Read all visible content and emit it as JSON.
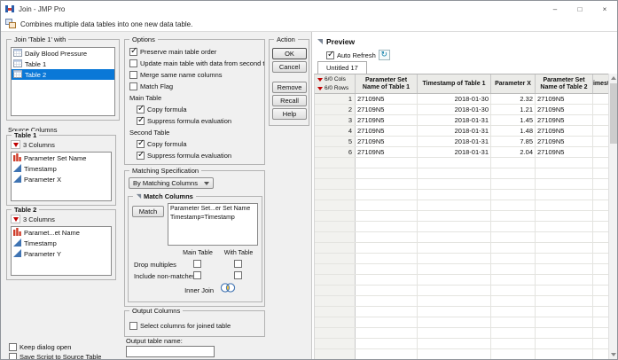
{
  "colors": {
    "selection": "#0a78d7",
    "nominal_red": "#cf3d2a",
    "continuous_blue": "#3f74b3",
    "hotspot_red": "#c00000"
  },
  "window": {
    "title": "Join - JMP Pro",
    "controls": {
      "minimize": "–",
      "maximize": "□",
      "close": "×"
    },
    "description": "Combines multiple data tables into one new data table."
  },
  "join_with": {
    "title": "Join 'Table 1' with",
    "items": [
      {
        "label": "Daily Blood Pressure",
        "selected": false
      },
      {
        "label": "Table 1",
        "selected": false
      },
      {
        "label": "Table 2",
        "selected": true
      }
    ]
  },
  "source_columns": {
    "label": "Source Columns",
    "table1": {
      "title": "Table 1",
      "count_label": "3 Columns",
      "columns": [
        {
          "name": "Parameter Set Name",
          "type": "nominal"
        },
        {
          "name": "Timestamp",
          "type": "continuous"
        },
        {
          "name": "Parameter X",
          "type": "continuous"
        }
      ]
    },
    "table2": {
      "title": "Table 2",
      "count_label": "3 Columns",
      "columns": [
        {
          "name": "Paramet...et Name",
          "type": "nominal"
        },
        {
          "name": "Timestamp",
          "type": "continuous"
        },
        {
          "name": "Parameter Y",
          "type": "continuous"
        }
      ]
    }
  },
  "options": {
    "title": "Options",
    "items": [
      {
        "label": "Preserve main table order",
        "checked": true
      },
      {
        "label": "Update main table with data from second table",
        "checked": false
      },
      {
        "label": "Merge same name columns",
        "checked": false
      },
      {
        "label": "Match Flag",
        "checked": false
      }
    ],
    "main_table_label": "Main Table",
    "main_table_items": [
      {
        "label": "Copy formula",
        "checked": true
      },
      {
        "label": "Suppress formula evaluation",
        "checked": true
      }
    ],
    "second_table_label": "Second Table",
    "second_table_items": [
      {
        "label": "Copy formula",
        "checked": true
      },
      {
        "label": "Suppress formula evaluation",
        "checked": true
      }
    ]
  },
  "matching": {
    "title": "Matching Specification",
    "method_dropdown": "By Matching Columns",
    "match_columns": {
      "title": "Match Columns",
      "match_button": "Match",
      "pairs": [
        "Parameter Set...er Set Name",
        "Timestamp=Timestamp"
      ],
      "col_headers": [
        "Main Table",
        "With Table"
      ],
      "option_rows": [
        {
          "label": "Drop multiples",
          "main": false,
          "with": false
        },
        {
          "label": "Include non-matches",
          "main": false,
          "with": false
        }
      ],
      "join_label": "Inner Join"
    }
  },
  "output_columns": {
    "title": "Output Columns",
    "checkbox_label": "Select columns for joined table",
    "checked": false
  },
  "output_name": {
    "label": "Output table name:",
    "value": ""
  },
  "action": {
    "title": "Action",
    "buttons": [
      "OK",
      "Cancel",
      "Remove",
      "Recall",
      "Help"
    ]
  },
  "preview": {
    "title": "Preview",
    "auto_refresh_label": "Auto Refresh",
    "auto_refresh_checked": true,
    "refresh_icon": "↻",
    "tab_label": "Untitled 17",
    "table": {
      "cols_badge": "6/0 Cols",
      "rows_badge": "6/0 Rows",
      "headers": [
        "Parameter Set Name of Table 1",
        "Timestamp of Table 1",
        "Parameter X",
        "Parameter Set Name of Table 2",
        "Timesta"
      ],
      "rows": [
        [
          "1",
          "27109N5",
          "2018-01-30",
          "2.32",
          "27109N5"
        ],
        [
          "2",
          "27109N5",
          "2018-01-30",
          "1.21",
          "27109N5"
        ],
        [
          "3",
          "27109N5",
          "2018-01-31",
          "1.45",
          "27109N5"
        ],
        [
          "4",
          "27109N5",
          "2018-01-31",
          "1.48",
          "27109N5"
        ],
        [
          "5",
          "27109N5",
          "2018-01-31",
          "7.85",
          "27109N5"
        ],
        [
          "6",
          "27109N5",
          "2018-01-31",
          "2.04",
          "27109N5"
        ]
      ]
    }
  },
  "footer": {
    "items": [
      {
        "label": "Keep dialog open",
        "checked": false
      },
      {
        "label": "Save Script to Source Table",
        "checked": false
      }
    ]
  }
}
